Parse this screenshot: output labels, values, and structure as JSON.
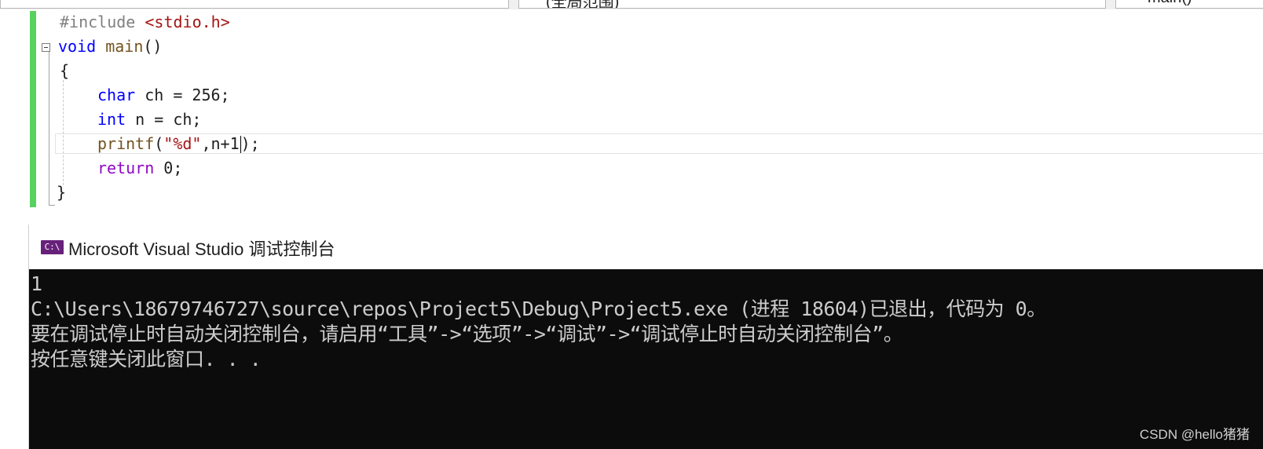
{
  "nav": {
    "project_dropdown": "",
    "scope_dropdown": "(全局范围)",
    "member_dropdown": "main()"
  },
  "editor": {
    "lines": [
      {
        "a": "#include ",
        "b": "<stdio.h>"
      },
      {
        "a": "void",
        "b": " main",
        "c": "()"
      },
      {
        "a": "{"
      },
      {
        "a": "char",
        "b": " ch = 256;"
      },
      {
        "a": "int",
        "b": " n = ch;"
      },
      {
        "a": "printf",
        "b": "(",
        "c": "\"%d\"",
        "d": ",n+1",
        "e": ");"
      },
      {
        "a": "return",
        "b": " 0;"
      },
      {
        "a": "}"
      }
    ]
  },
  "console": {
    "title": "Microsoft Visual Studio 调试控制台",
    "icon_label": "C:\\",
    "icon_name": "console-app-icon",
    "output": [
      "1",
      "C:\\Users\\18679746727\\source\\repos\\Project5\\Debug\\Project5.exe (进程 18604)已退出，代码为 0。",
      "要在调试停止时自动关闭控制台，请启用“工具”->“选项”->“调试”->“调试停止时自动关闭控制台”。",
      "按任意键关闭此窗口. . ."
    ],
    "watermark": "CSDN @hello猪猪"
  }
}
